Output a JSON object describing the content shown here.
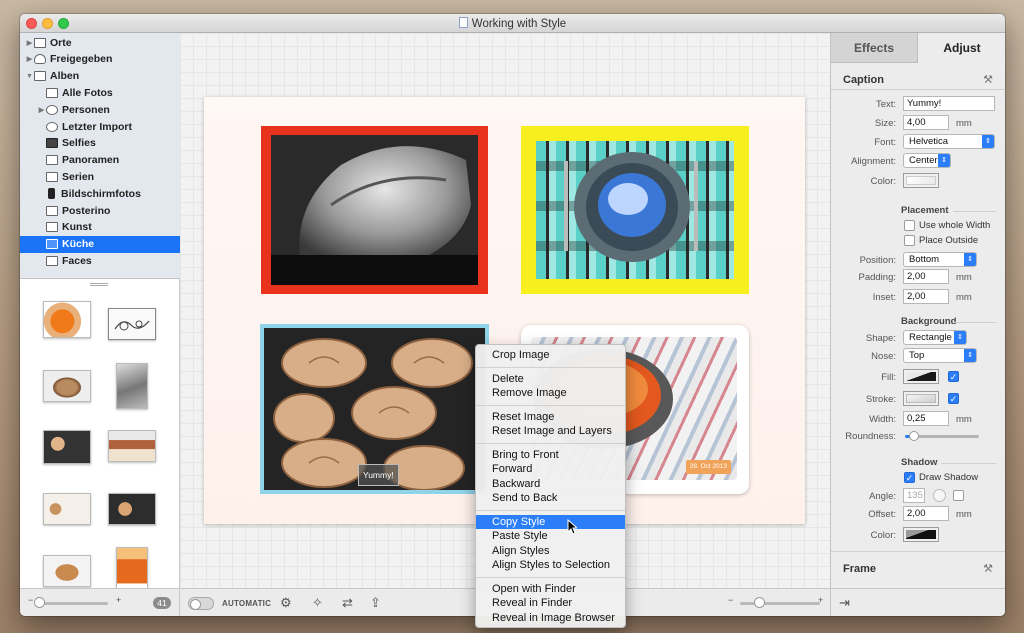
{
  "window": {
    "title": "Working with Style"
  },
  "sidebar": {
    "items": [
      {
        "label": "Orte",
        "icon": "folder-icon",
        "indent": 0,
        "disclosure": "▶"
      },
      {
        "label": "Freigegeben",
        "icon": "cloud-icon",
        "indent": 0,
        "disclosure": "▶"
      },
      {
        "label": "Alben",
        "icon": "folder-icon",
        "indent": 0,
        "disclosure": "▼"
      },
      {
        "label": "Alle Fotos",
        "icon": "album-icon",
        "indent": 1,
        "disclosure": ""
      },
      {
        "label": "Personen",
        "icon": "person-icon",
        "indent": 1,
        "disclosure": "▶"
      },
      {
        "label": "Letzter Import",
        "icon": "clock-icon",
        "indent": 1,
        "disclosure": ""
      },
      {
        "label": "Selfies",
        "icon": "camera-icon",
        "indent": 1,
        "disclosure": ""
      },
      {
        "label": "Panoramen",
        "icon": "panorama-icon",
        "indent": 1,
        "disclosure": ""
      },
      {
        "label": "Serien",
        "icon": "album-icon",
        "indent": 1,
        "disclosure": ""
      },
      {
        "label": "Bildschirmfotos",
        "icon": "phone-icon",
        "indent": 1,
        "disclosure": ""
      },
      {
        "label": "Posterino",
        "icon": "album-icon",
        "indent": 1,
        "disclosure": ""
      },
      {
        "label": "Kunst",
        "icon": "album-icon",
        "indent": 1,
        "disclosure": ""
      },
      {
        "label": "Küche",
        "icon": "album-icon",
        "indent": 1,
        "disclosure": "",
        "selected": true
      },
      {
        "label": "Faces",
        "icon": "album-icon",
        "indent": 1,
        "disclosure": ""
      }
    ],
    "photo_count": "41"
  },
  "canvas": {
    "caption_text": "Yummy!",
    "date_badge": "28. Oct 2013",
    "toolbar": {
      "auto_label": "AUTOMATIC"
    },
    "frame_colors": {
      "red": "#e8321e",
      "yellow": "#f7f01e",
      "blue": "#8fd3e8",
      "white": "#ffffff"
    }
  },
  "inspector": {
    "tabs": {
      "effects": "Effects",
      "adjust": "Adjust"
    },
    "caption": {
      "heading": "Caption",
      "text_label": "Text:",
      "text_value": "Yummy!",
      "size_label": "Size:",
      "size_value": "4,00",
      "size_unit": "mm",
      "font_label": "Font:",
      "font_value": "Helvetica",
      "alignment_label": "Alignment:",
      "alignment_value": "Center",
      "color_label": "Color:"
    },
    "placement": {
      "heading": "Placement",
      "whole_width": "Use whole Width",
      "place_outside": "Place Outside",
      "position_label": "Position:",
      "position_value": "Bottom",
      "padding_label": "Padding:",
      "padding_value": "2,00",
      "padding_unit": "mm",
      "inset_label": "Inset:",
      "inset_value": "2,00",
      "inset_unit": "mm"
    },
    "background": {
      "heading": "Background",
      "shape_label": "Shape:",
      "shape_value": "Rectangle",
      "nose_label": "Nose:",
      "nose_value": "Top",
      "fill_label": "Fill:",
      "stroke_label": "Stroke:",
      "width_label": "Width:",
      "width_value": "0,25",
      "width_unit": "mm",
      "roundness_label": "Roundness:",
      "roundness_level": 0.12
    },
    "shadow": {
      "heading": "Shadow",
      "draw_shadow": "Draw Shadow",
      "angle_label": "Angle:",
      "angle_value": "135",
      "offset_label": "Offset:",
      "offset_value": "2,00",
      "offset_unit": "mm",
      "color_label": "Color:"
    },
    "frame": {
      "heading": "Frame"
    }
  },
  "context_menu": {
    "groups": [
      [
        "Crop Image"
      ],
      [
        "Delete",
        "Remove Image"
      ],
      [
        "Reset Image",
        "Reset Image and Layers"
      ],
      [
        "Bring to Front",
        "Forward",
        "Backward",
        "Send to Back"
      ],
      [
        "Copy Style",
        "Paste Style",
        "Align Styles",
        "Align Styles to Selection"
      ],
      [
        "Open with Finder",
        "Reveal in Finder",
        "Reveal in Image Browser"
      ]
    ],
    "highlighted": "Copy Style"
  },
  "colors": {
    "accent": "#2b7ef7",
    "sidebar_selection": "#1b74f5"
  }
}
